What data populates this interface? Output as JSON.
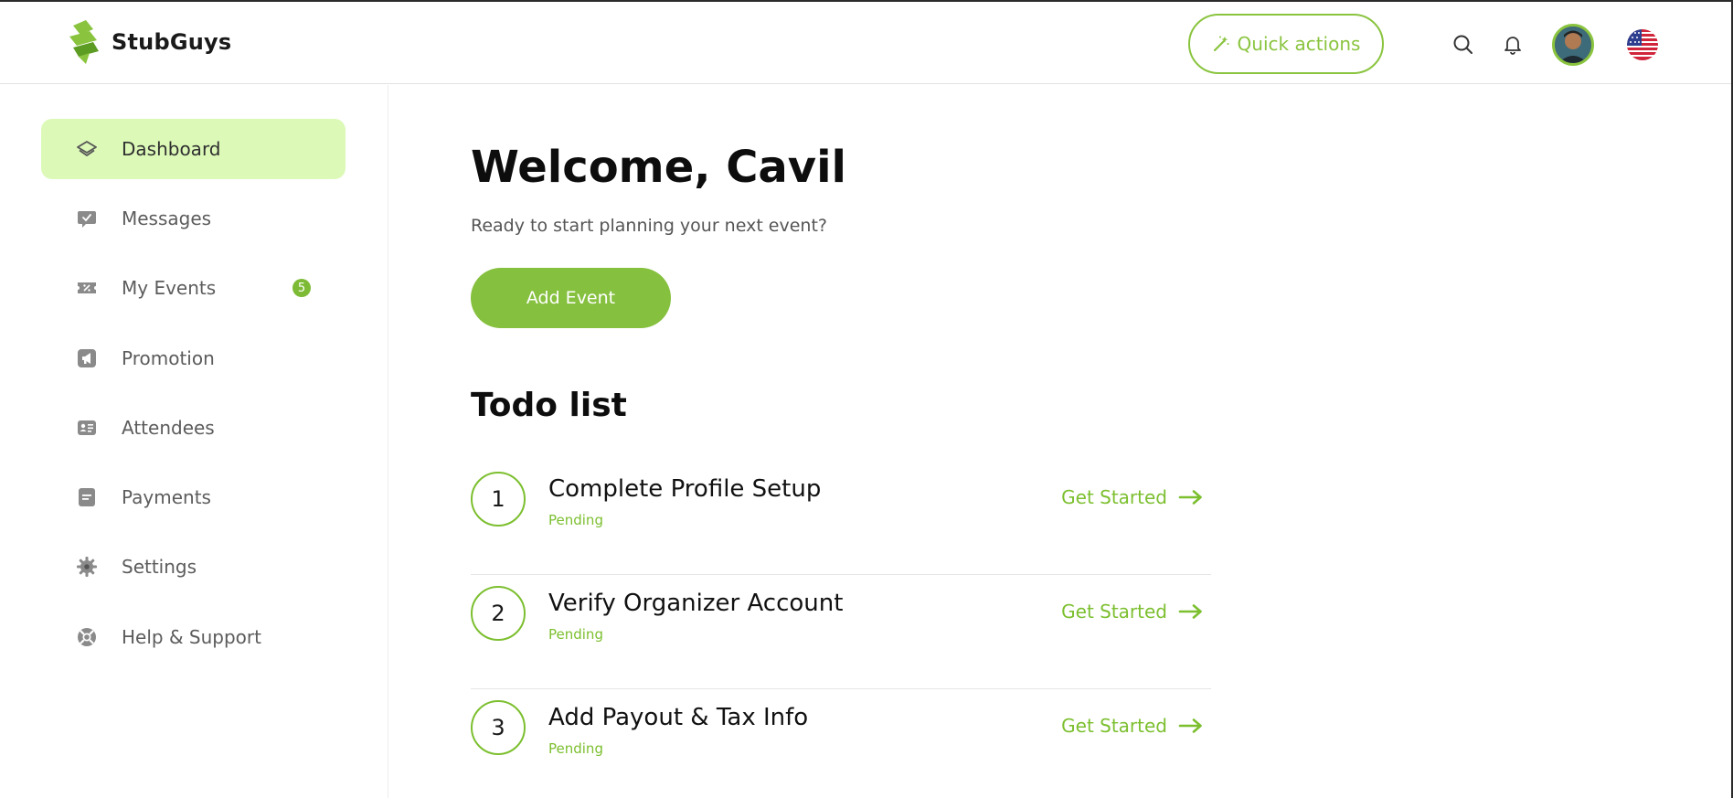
{
  "brand": {
    "name": "StubGuys",
    "accent": "#8ac43f",
    "accent_light": "#dcf9b8"
  },
  "header": {
    "quick_actions_label": "Quick actions",
    "icons": [
      "magic-wand-icon",
      "search-icon",
      "bell-icon",
      "avatar",
      "us-flag-icon"
    ]
  },
  "sidebar": {
    "items": [
      {
        "label": "Dashboard",
        "icon": "layers-icon",
        "active": true
      },
      {
        "label": "Messages",
        "icon": "message-check-icon"
      },
      {
        "label": "My Events",
        "icon": "ticket-icon",
        "badge": "5"
      },
      {
        "label": "Promotion",
        "icon": "megaphone-icon"
      },
      {
        "label": "Attendees",
        "icon": "id-card-icon"
      },
      {
        "label": "Payments",
        "icon": "document-icon"
      },
      {
        "label": "Settings",
        "icon": "gear-icon"
      },
      {
        "label": "Help & Support",
        "icon": "lifebuoy-icon"
      }
    ]
  },
  "main": {
    "welcome": "Welcome, Cavil",
    "subtitle": "Ready to start planning your next event?",
    "add_event_label": "Add Event",
    "todo_title": "Todo list",
    "todos": [
      {
        "number": "1",
        "title": "Complete Profile Setup",
        "status": "Pending",
        "action": "Get Started"
      },
      {
        "number": "2",
        "title": "Verify Organizer Account",
        "status": "Pending",
        "action": "Get Started"
      },
      {
        "number": "3",
        "title": "Add Payout & Tax Info",
        "status": "Pending",
        "action": "Get Started"
      }
    ]
  }
}
